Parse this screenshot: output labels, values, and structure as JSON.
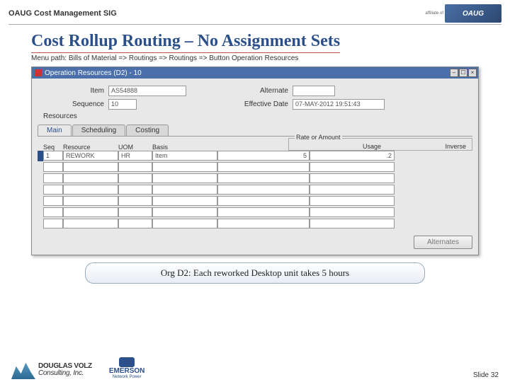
{
  "header": {
    "title": "OAUG Cost Management SIG",
    "affiliate_txt": "affiliate of",
    "oaug": "OAUG"
  },
  "slide": {
    "title": "Cost Rollup Routing – No Assignment Sets",
    "menu_path": "Menu path:  Bills of Material => Routings => Routings => Button Operation Resources",
    "callout": "Org D2:  Each reworked Desktop unit takes 5 hours",
    "slide_num": "Slide 32"
  },
  "window": {
    "title": "Operation Resources (D2) - 10",
    "labels": {
      "item": "Item",
      "alternate": "Alternate",
      "sequence": "Sequence",
      "effective": "Effective Date",
      "resources": "Resources",
      "rate": "Rate or Amount",
      "alternates_btn": "Alternates"
    },
    "values": {
      "item": "AS54888",
      "alternate": "",
      "sequence": "10",
      "effective": "07-MAY-2012 19:51:43"
    },
    "tabs": [
      "Main",
      "Scheduling",
      "Costing"
    ],
    "active_tab": 0,
    "columns": {
      "seq": "Seq",
      "resource": "Resource",
      "uom": "UOM",
      "basis": "Basis",
      "usage": "Usage",
      "inverse": "Inverse"
    },
    "rows": [
      {
        "seq": "1",
        "resource": "REWORK",
        "uom": "HR",
        "basis": "Item",
        "usage": "5",
        "inverse": ".2"
      }
    ]
  },
  "footer": {
    "dvc1": "DOUGLAS VOLZ",
    "dvc2": "Consulting, Inc.",
    "em1": "EMERSON",
    "em2": "Network Power"
  }
}
